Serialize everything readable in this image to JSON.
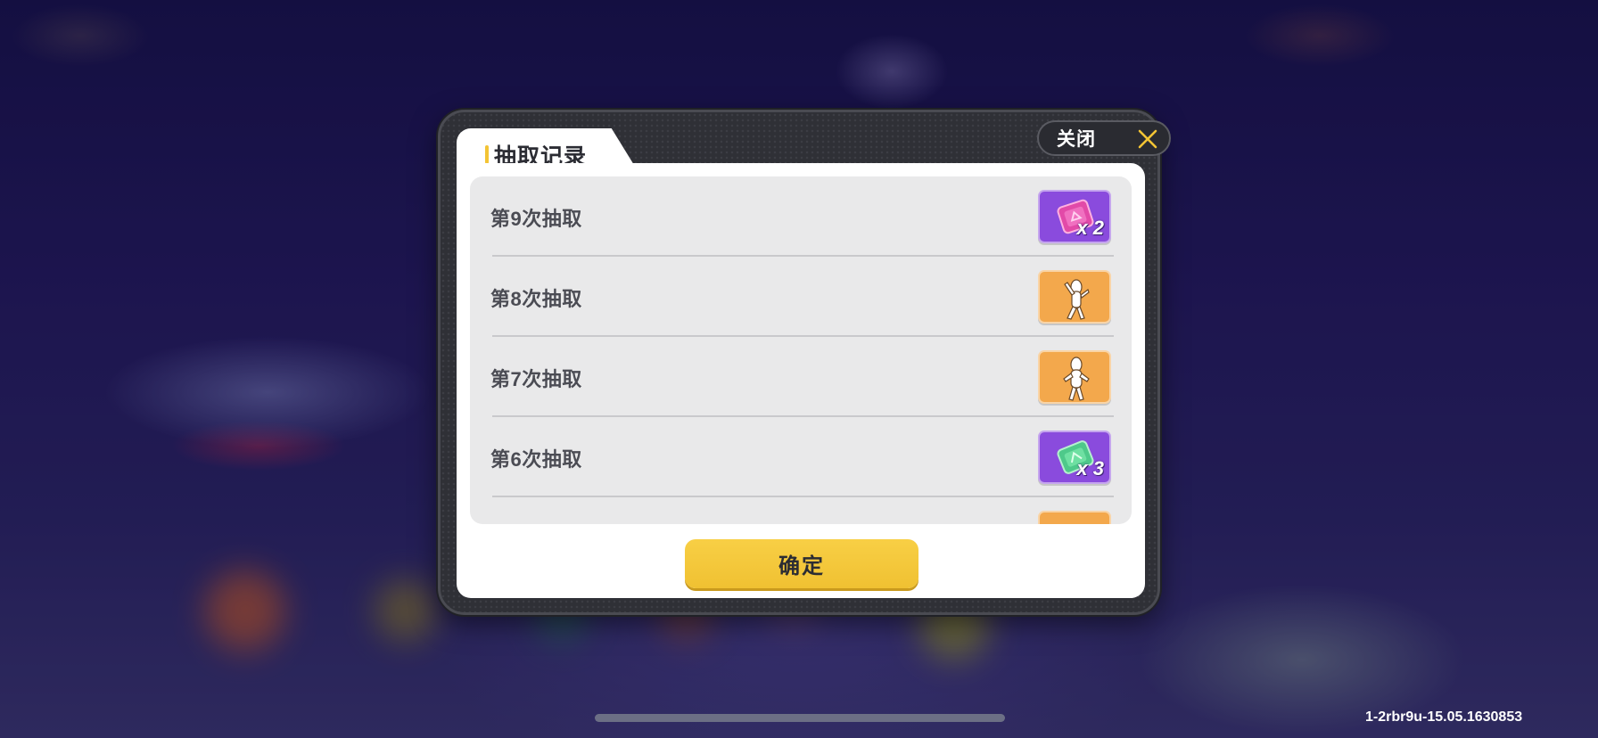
{
  "dialog": {
    "title": "抽取记录",
    "close_label": "关闭",
    "confirm_label": "确定",
    "records": [
      {
        "label": "第9次抽取",
        "reward_icon": "pink-gem-card-icon",
        "reward_color": "#8a4bdd",
        "count": "x 2"
      },
      {
        "label": "第8次抽取",
        "reward_icon": "dance-pose-emote-icon",
        "reward_color": "#f3a84c",
        "count": ""
      },
      {
        "label": "第7次抽取",
        "reward_icon": "standing-pose-emote-icon",
        "reward_color": "#f3a84c",
        "count": ""
      },
      {
        "label": "第6次抽取",
        "reward_icon": "green-gem-card-icon",
        "reward_color": "#8a4bdd",
        "count": "x 3"
      }
    ]
  },
  "footer": {
    "version": "1-2rbr9u-15.05.1630853"
  },
  "colors": {
    "accent_yellow": "#f3c434",
    "close_icon": "#f3c434",
    "purple_tile": "#8a4bdd",
    "orange_tile": "#f3a84c"
  }
}
